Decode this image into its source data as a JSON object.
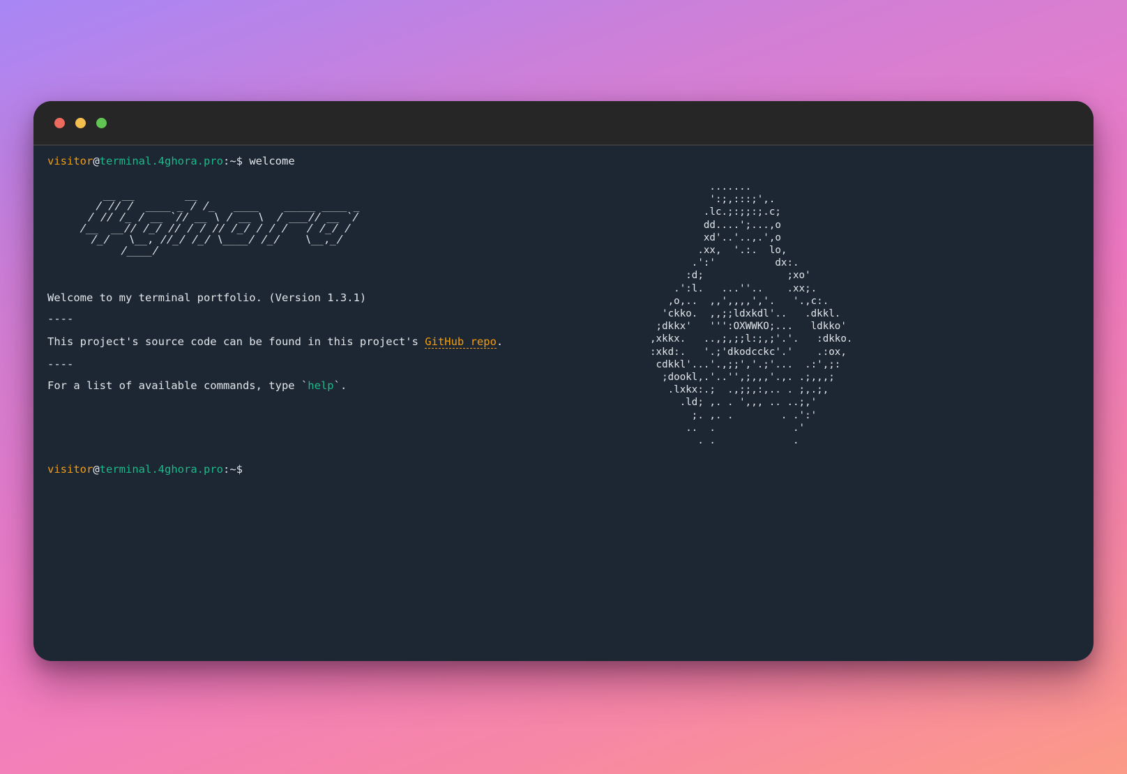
{
  "window": {
    "dots": [
      "close",
      "minimize",
      "maximize"
    ]
  },
  "prompt": {
    "user": "visitor",
    "at": "@",
    "host": "terminal.4ghora.pro",
    "path": ":~$"
  },
  "history": {
    "command": "welcome"
  },
  "logo_ascii": "   __ __        __\n  / // /  ____ _ / /_   ____    _____ ____ _\n / // /_ / __ `// __ \\ / __ \\  / ___// __ `/\n/__  __// /_/ // / / // /_/ / / /   / /_/ /\n  /_/   \\__, //_/ /_/ \\____/ /_/    \\__,_/\n       /____/",
  "art_ascii": "          .......\n          ':;,:::;',.\n         .lc.;:;;:;.c;\n         dd....';...,o\n         xd'..'..,.',o\n        .xx,  '.:.  lo,\n       .':'          dx:.\n      :d;              ;xo'\n    .':l.   ...''..    .xx;.\n   ,o,..  ,,',,,,','.   '.,c:.\n  'ckko.  ,,;;ldxkdl'..   .dkkl.\n ;dkkx'   ''':OXWWKO;...   ldkko'\n,xkkx.   ..,;,;;l:;,;'.'.   :dkko.\n:xkd:.   '.;'dkodcckc'.'    .:ox,\n cdkkl'...'.,;;','.;'...  .:',;:\n  ;dookl,.'..'',;,,,'.,. .;,,,;\n   .lxkx:.;  .,;;,:,.. . ;,.;,\n     .ld; ,. . ',,, .. ..;,'\n       ;. ,. .        . .':'\n      ..  .             .'\n        . .             .",
  "welcome": {
    "line1": "Welcome to my terminal portfolio. (Version 1.3.1)",
    "separator": "----",
    "source_prefix": "This project's source code can be found in this project's ",
    "source_link": "GitHub repo",
    "source_suffix": ".",
    "separator2": "----",
    "help_prefix": "For a list of available commands, type `",
    "help_cmd": "help",
    "help_suffix": "`."
  }
}
